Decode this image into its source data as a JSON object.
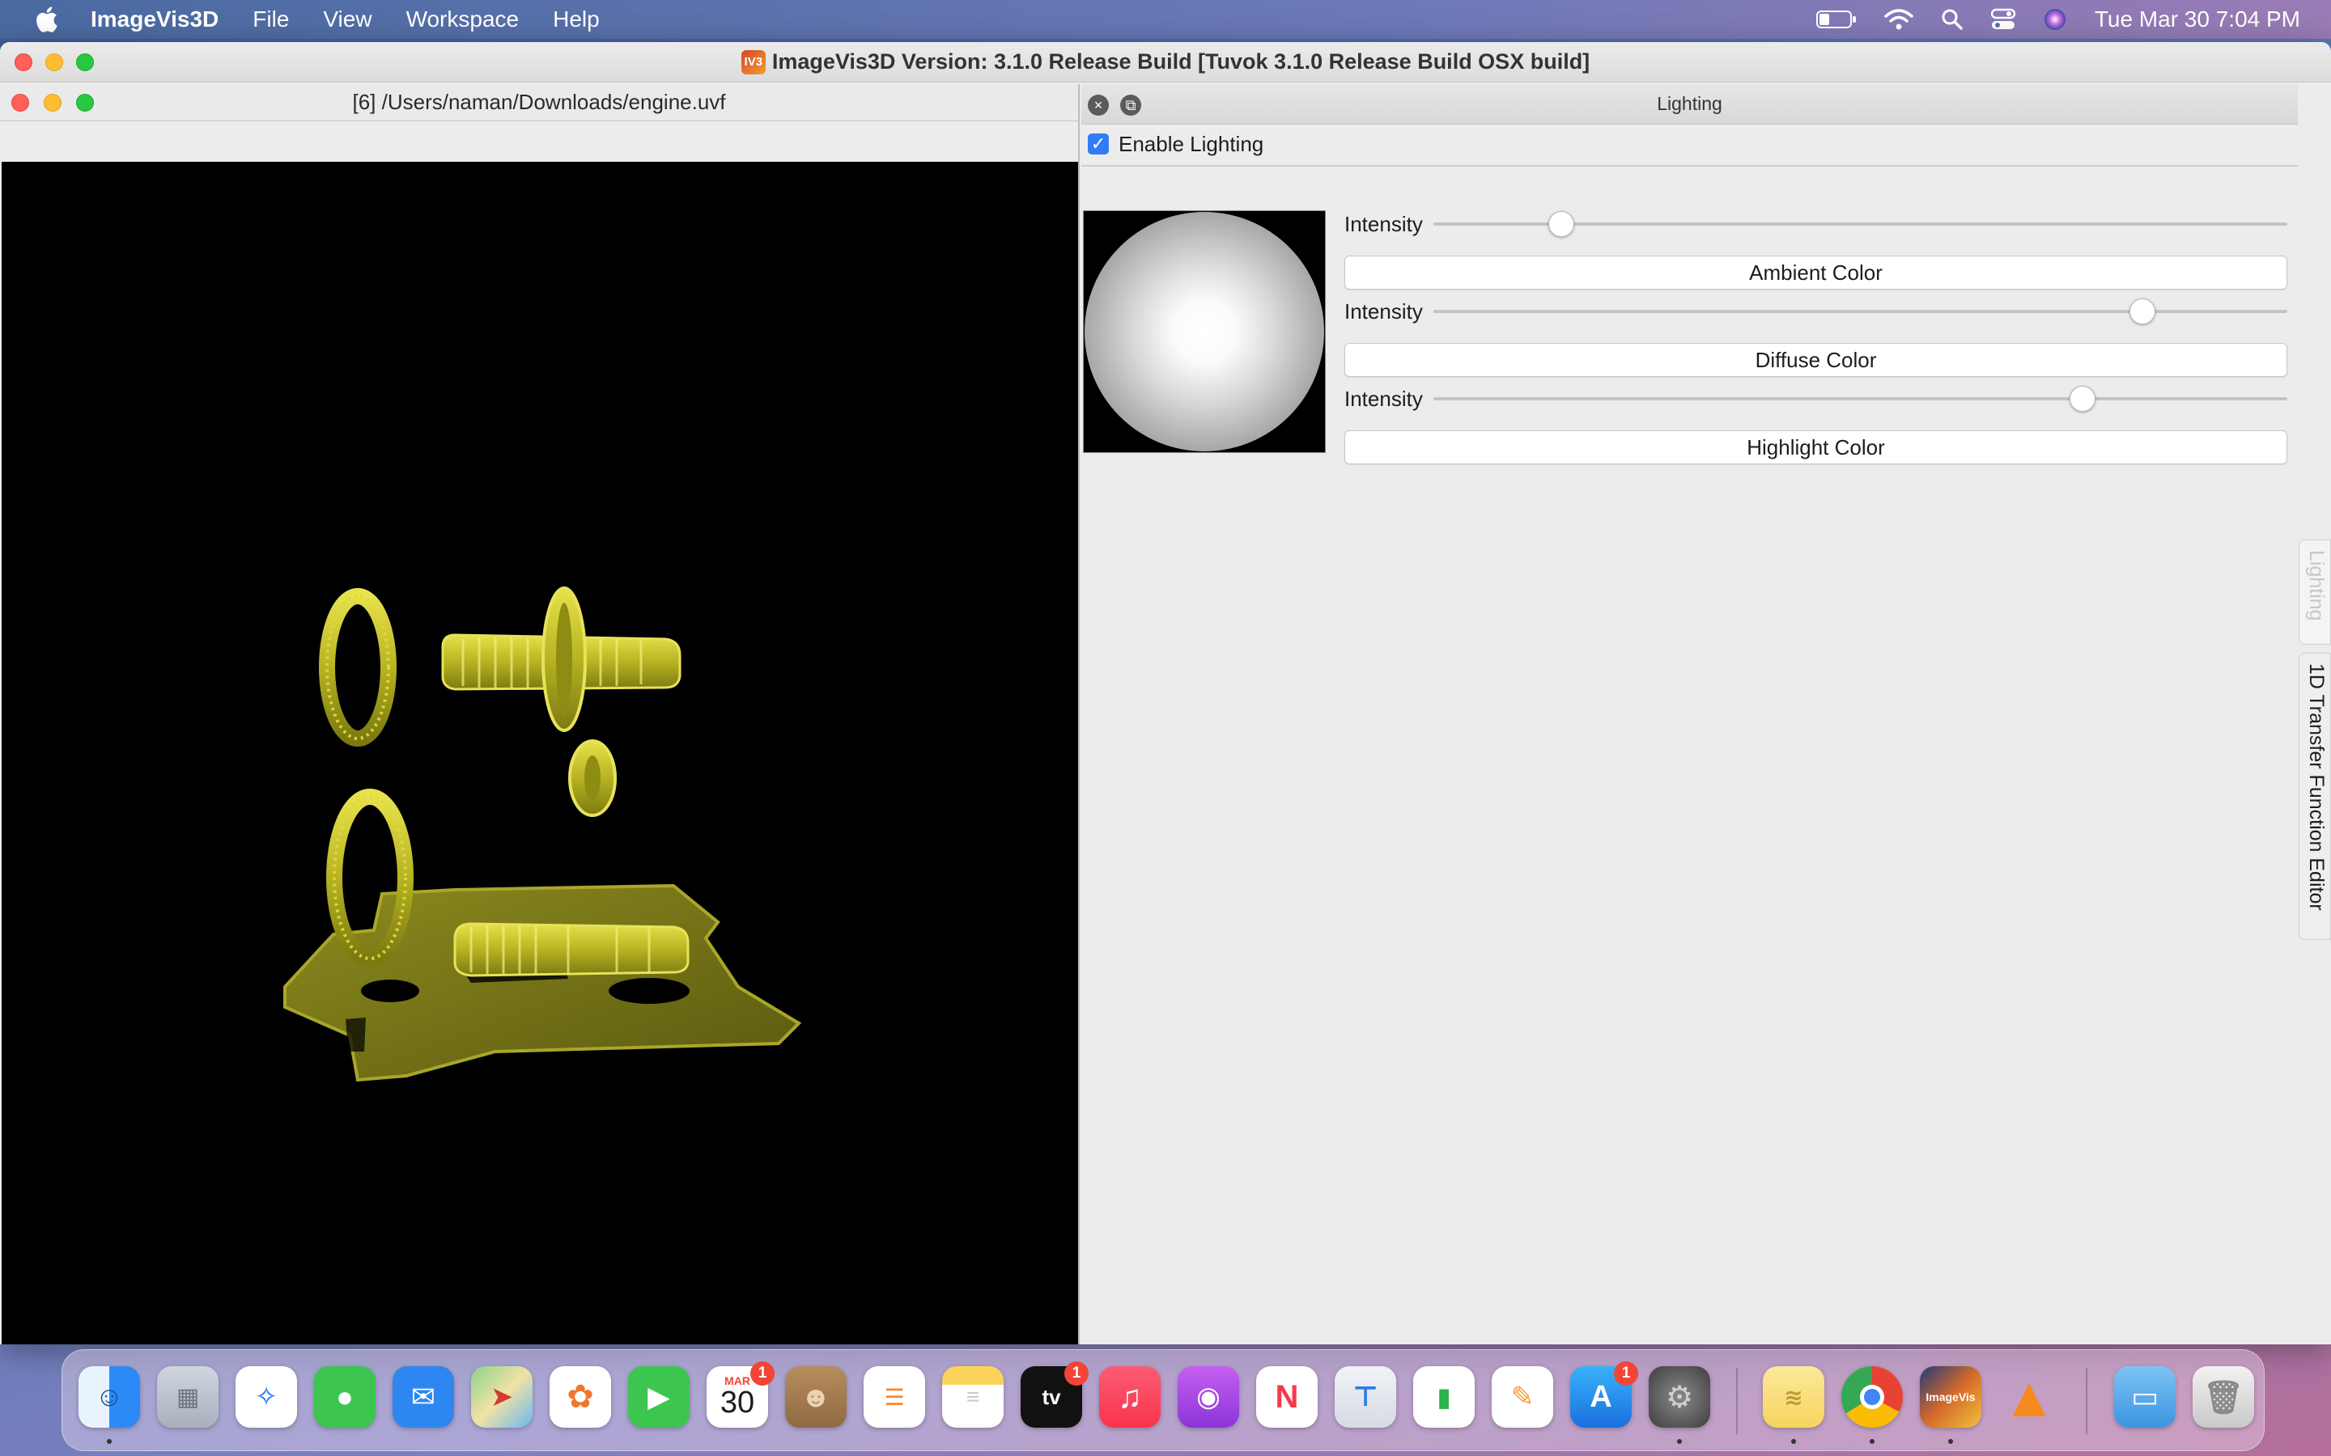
{
  "menubar": {
    "app_name": "ImageVis3D",
    "items": [
      "File",
      "View",
      "Workspace",
      "Help"
    ],
    "clock": "Tue Mar 30  7:04 PM"
  },
  "main_window": {
    "title": "ImageVis3D Version: 3.1.0 Release Build [Tuvok 3.1.0 Release Build OSX build]",
    "badge": "IV3"
  },
  "render_window": {
    "title": "[6] /Users/naman/Downloads/engine.uvf",
    "volume_color": "#c9c62a",
    "background_color": "#000000"
  },
  "lighting": {
    "panel_title": "Lighting",
    "enable_label": "Enable Lighting",
    "enabled": true,
    "ambient": {
      "intensity_label": "Intensity",
      "intensity": 0.15,
      "button": "Ambient Color"
    },
    "diffuse": {
      "intensity_label": "Intensity",
      "intensity": 0.83,
      "button": "Diffuse Color"
    },
    "highlight": {
      "intensity_label": "Intensity",
      "intensity": 0.76,
      "button": "Highlight Color"
    }
  },
  "side_tabs": {
    "lighting": "Lighting",
    "tf1d": "1D Transfer Function Editor"
  },
  "dock": {
    "calendar_month": "MAR",
    "calendar_day": "30",
    "tv_label": "tv",
    "calendar_badge": "1",
    "tv_badge": "1",
    "appstore_badge": "1",
    "imagevis_label": "ImageVis"
  }
}
